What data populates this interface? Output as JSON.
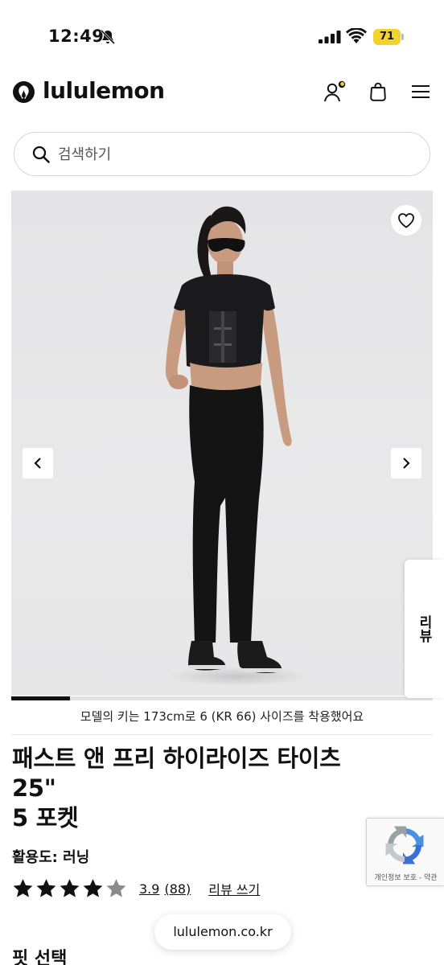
{
  "status_bar": {
    "time": "12:49",
    "battery": "71"
  },
  "header": {
    "brand": "lululemon"
  },
  "search": {
    "placeholder": "검색하기"
  },
  "gallery": {
    "progress_fraction": 0.14
  },
  "reviews_tab": {
    "label": "리뷰"
  },
  "product": {
    "model_note": "모델의 키는 173cm로 6 (KR 66) 사이즈를 착용했어요",
    "title_line1": "패스트 앤 프리 하이라이즈 타이츠",
    "title_line2": "25\"",
    "title_line3": "5 포켓",
    "activity": "활용도: 러닝",
    "rating": {
      "value": "3.9",
      "count": "(88)",
      "stars_filled": 4,
      "stars_total": 5,
      "write_review": "리뷰 쓰기"
    },
    "fit_heading": "핏 선택"
  },
  "recaptcha": {
    "text": "개인정보 보호 - 약관"
  },
  "browser": {
    "url": "lululemon.co.kr"
  },
  "colors": {
    "battery": "#f2d22e",
    "text": "#111111",
    "gallery_bg": "#e6e6e7"
  }
}
